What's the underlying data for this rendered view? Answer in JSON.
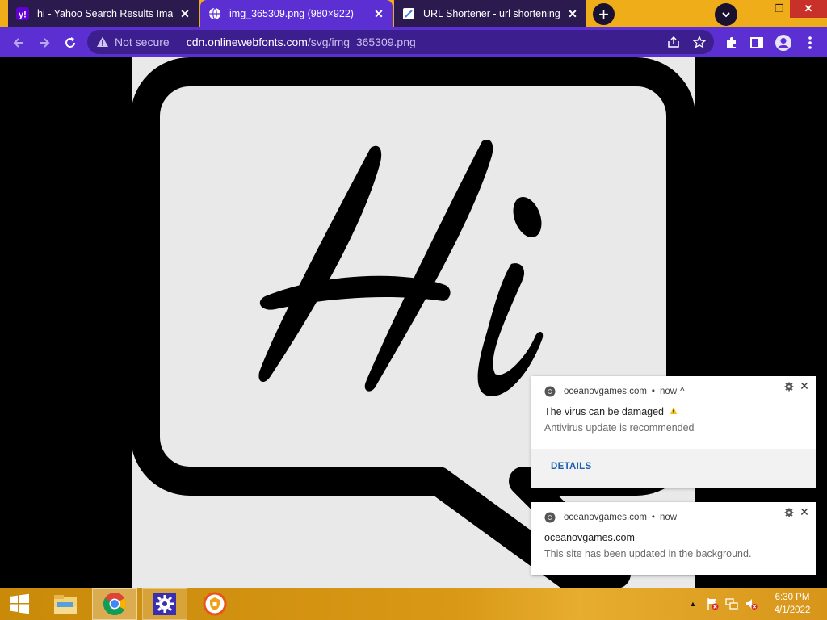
{
  "tabs": [
    {
      "title": "hi - Yahoo Search Results Image",
      "favicon": "yahoo-icon"
    },
    {
      "title": "img_365309.png (980×922)",
      "favicon": "globe-icon"
    },
    {
      "title": "URL Shortener - url shortening se",
      "favicon": "link-icon"
    }
  ],
  "toolbar": {
    "security_label": "Not secure",
    "url_host": "cdn.onlinewebfonts.com",
    "url_path": "/svg/img_365309.png"
  },
  "image": {
    "text": "Hi"
  },
  "notifications": [
    {
      "origin": "oceanovgames.com",
      "time": "now",
      "expand_glyph": "^",
      "title": "The virus can be damaged",
      "title_icon": "warning-icon",
      "body": "Antivirus update is recommended",
      "action": "DETAILS"
    },
    {
      "origin": "oceanovgames.com",
      "time": "now",
      "title": "oceanovgames.com",
      "body": "This site has been updated in the background."
    }
  ],
  "taskbar": {
    "time": "6:30 PM",
    "date": "4/1/2022"
  },
  "colors": {
    "tabstrip": "#f0ad1a",
    "toolbar": "#5c2fd3",
    "taskbar": "#d99816",
    "link_blue": "#1a5fb4"
  }
}
